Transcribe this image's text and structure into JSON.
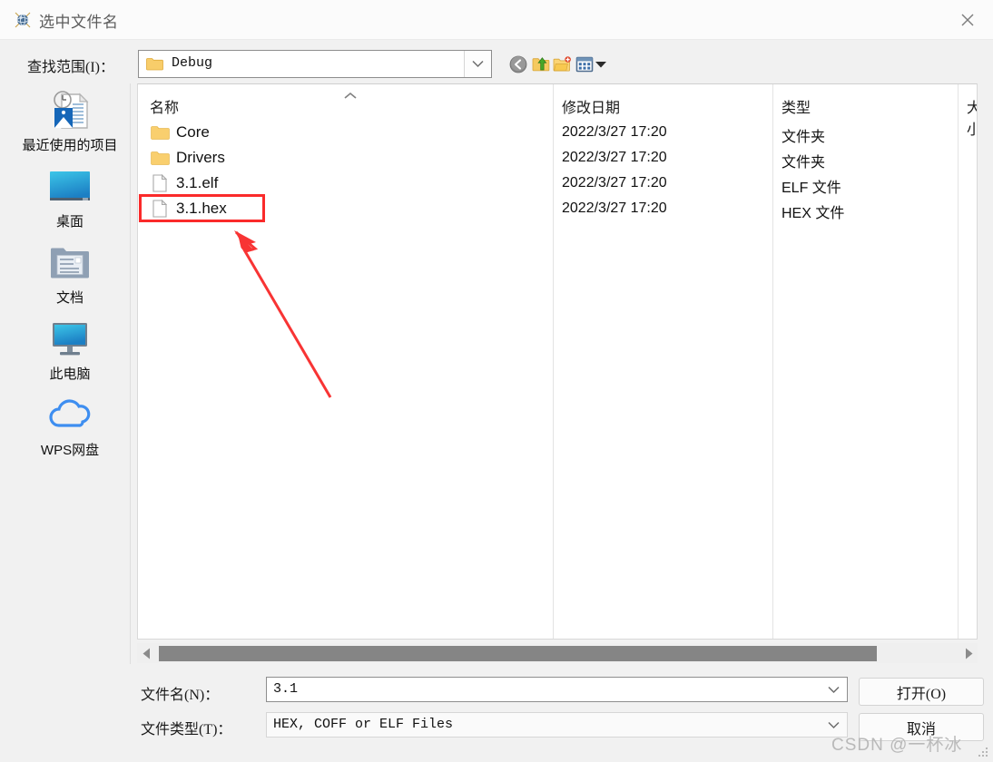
{
  "window": {
    "title": "选中文件名",
    "title_icon": "globe-icon",
    "close_icon": "close-icon"
  },
  "lookin": {
    "label": "查找范围(I)：",
    "value": "Debug",
    "folder_icon": "folder-icon",
    "dropdown_icon": "chevron-down-icon"
  },
  "toolbar": {
    "back": "back-icon",
    "up": "up-folder-icon",
    "new_folder": "new-folder-icon",
    "views": "views-icon",
    "views_arrow": "chevron-down-icon"
  },
  "places": [
    {
      "label": "最近使用的项目",
      "icon": "recent-items-icon"
    },
    {
      "label": "桌面",
      "icon": "desktop-icon"
    },
    {
      "label": "文档",
      "icon": "documents-icon"
    },
    {
      "label": "此电脑",
      "icon": "this-pc-icon"
    },
    {
      "label": "WPS网盘",
      "icon": "cloud-icon"
    }
  ],
  "filelist": {
    "columns": [
      "名称",
      "修改日期",
      "类型",
      "大小"
    ],
    "sort_icon": "sort-ascending-icon",
    "rows": [
      {
        "name": "Core",
        "date": "2022/3/27 17:20",
        "type": "文件夹",
        "size": "",
        "icon": "folder-icon"
      },
      {
        "name": "Drivers",
        "date": "2022/3/27 17:20",
        "type": "文件夹",
        "size": "",
        "icon": "folder-icon"
      },
      {
        "name": "3.1.elf",
        "date": "2022/3/27 17:20",
        "type": "ELF 文件",
        "size": "",
        "icon": "file-icon"
      },
      {
        "name": "3.1.hex",
        "date": "2022/3/27 17:20",
        "type": "HEX 文件",
        "size": "",
        "icon": "file-icon"
      }
    ]
  },
  "scrollbar": {
    "left_icon": "triangle-left-icon",
    "right_icon": "triangle-right-icon"
  },
  "form": {
    "filename_label": "文件名(N)：",
    "filename_value": "3.1",
    "filetype_label": "文件类型(T)：",
    "filetype_value": "HEX, COFF or ELF Files",
    "dropdown_icon": "chevron-down-icon"
  },
  "buttons": {
    "open": "打开(O)",
    "cancel": "取消"
  },
  "annotations": {
    "highlight_target": "3.1.hex",
    "highlight_color": "#fa2a2a",
    "arrow_color": "#f83434"
  },
  "watermark": "CSDN @一杯冰"
}
